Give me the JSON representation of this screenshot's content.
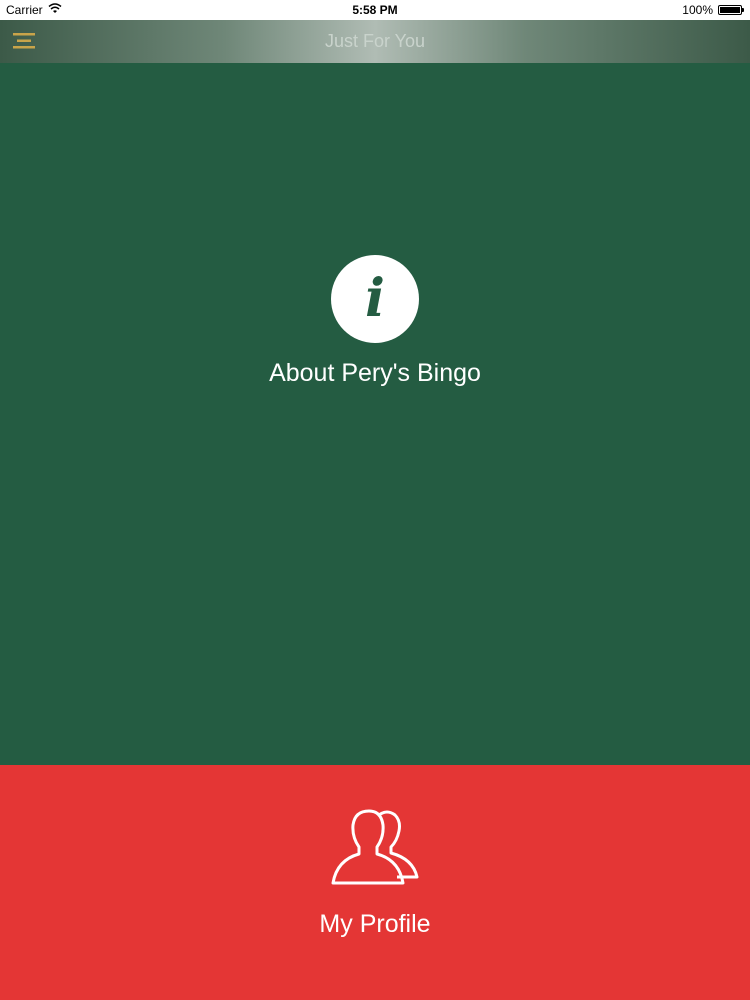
{
  "status_bar": {
    "carrier": "Carrier",
    "time": "5:58 PM",
    "battery": "100%",
    "battery_level": 1.0
  },
  "nav": {
    "title": "Just For You",
    "menu_icon": "hamburger-menu-icon",
    "menu_icon_color": "#c9a44a"
  },
  "about": {
    "label": "About Pery's Bingo",
    "icon": "info-icon",
    "background": "#245c42"
  },
  "profile": {
    "label": "My Profile",
    "icon": "users-icon",
    "background": "#e43635"
  }
}
